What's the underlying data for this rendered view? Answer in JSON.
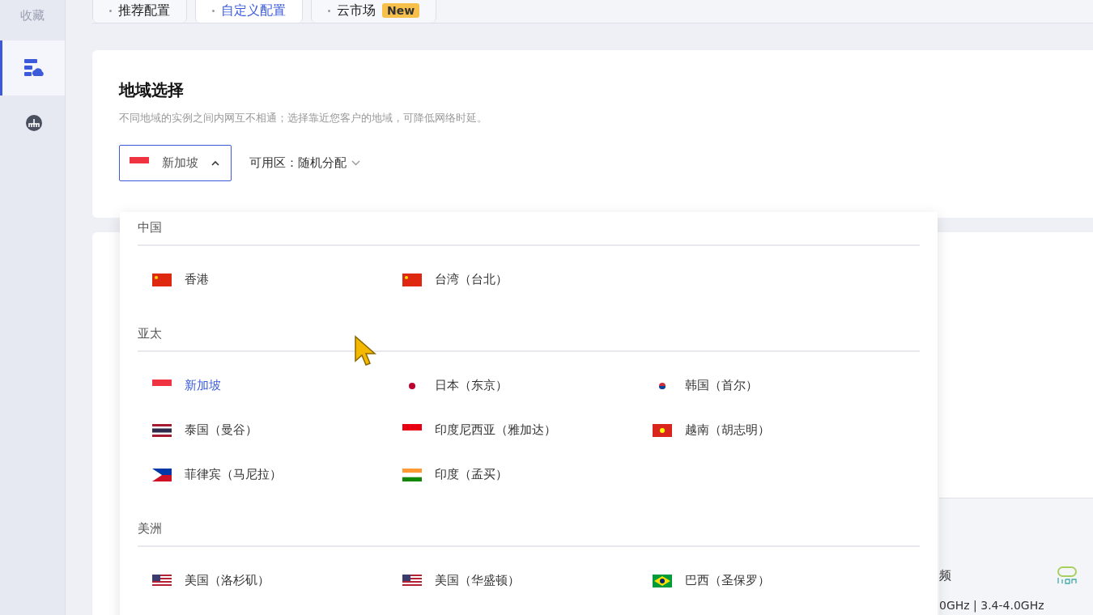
{
  "sidebar": {
    "title": "收藏",
    "items": [
      {
        "kind": "servers",
        "selected": true
      },
      {
        "kind": "network",
        "selected": false
      }
    ]
  },
  "tabs": [
    {
      "label": "推荐配置",
      "selected": false
    },
    {
      "label": "自定义配置",
      "selected": true
    },
    {
      "label": "云市场",
      "selected": false,
      "badge": "New"
    }
  ],
  "region": {
    "title": "地域选择",
    "description": "不同地域的实例之间内网互不相通；选择靠近您客户的地域，可降低网络时延。",
    "value": {
      "label": "新加坡",
      "kind": "sg"
    },
    "expanded": true,
    "zone_label": "可用区：",
    "zone_value": "随机分配"
  },
  "dropdown": {
    "groups": [
      {
        "name": "中国",
        "items": [
          {
            "label": "香港",
            "kind": "cn",
            "selected": false
          },
          {
            "label": "台湾（台北）",
            "kind": "cn",
            "selected": false
          }
        ]
      },
      {
        "name": "亚太",
        "items": [
          {
            "label": "新加坡",
            "kind": "sg",
            "selected": true
          },
          {
            "label": "日本（东京）",
            "kind": "jp",
            "selected": false
          },
          {
            "label": "韩国（首尔）",
            "kind": "kr",
            "selected": false
          },
          {
            "label": "泰国（曼谷）",
            "kind": "th",
            "selected": false
          },
          {
            "label": "印度尼西亚（雅加达）",
            "kind": "id",
            "selected": false
          },
          {
            "label": "越南（胡志明）",
            "kind": "vn",
            "selected": false
          },
          {
            "label": "菲律宾（马尼拉）",
            "kind": "ph",
            "selected": false
          },
          {
            "label": "印度（孟买）",
            "kind": "in",
            "selected": false
          }
        ]
      },
      {
        "name": "美洲",
        "items": [
          {
            "label": "美国（洛杉矶）",
            "kind": "us",
            "selected": false
          },
          {
            "label": "美国（华盛顿）",
            "kind": "us",
            "selected": false
          },
          {
            "label": "巴西（圣保罗）",
            "kind": "br",
            "selected": false
          }
        ]
      }
    ]
  },
  "side_panel": {
    "label": "频",
    "value": "0GHz | 3.4-4.0GHz"
  }
}
